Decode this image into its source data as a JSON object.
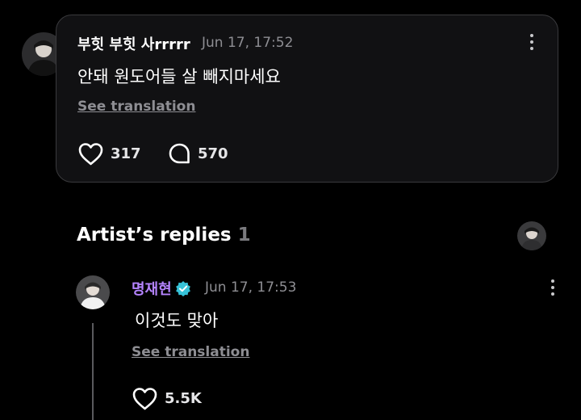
{
  "post": {
    "author": "부힛 부힛 사rrrrr",
    "timestamp": "Jun 17, 17:52",
    "text": "안돼 원도어들 살 빼지마세요",
    "see_translation": "See translation",
    "likes": "317",
    "comments": "570"
  },
  "artist_replies": {
    "title": "Artist’s replies",
    "count": "1"
  },
  "reply": {
    "author": "명재현",
    "timestamp": "Jun 17, 17:53",
    "text": "이것도 맞아",
    "see_translation": "See translation",
    "likes": "5.5K"
  },
  "colors": {
    "background": "#000000",
    "card": "#111113",
    "artist_name": "#b584ff",
    "verified_badge": "#36c2d8",
    "muted_text": "#8e8e93"
  },
  "icons": [
    "heart-icon",
    "comment-bubble-icon",
    "more-vertical-icon",
    "verified-badge-icon"
  ]
}
